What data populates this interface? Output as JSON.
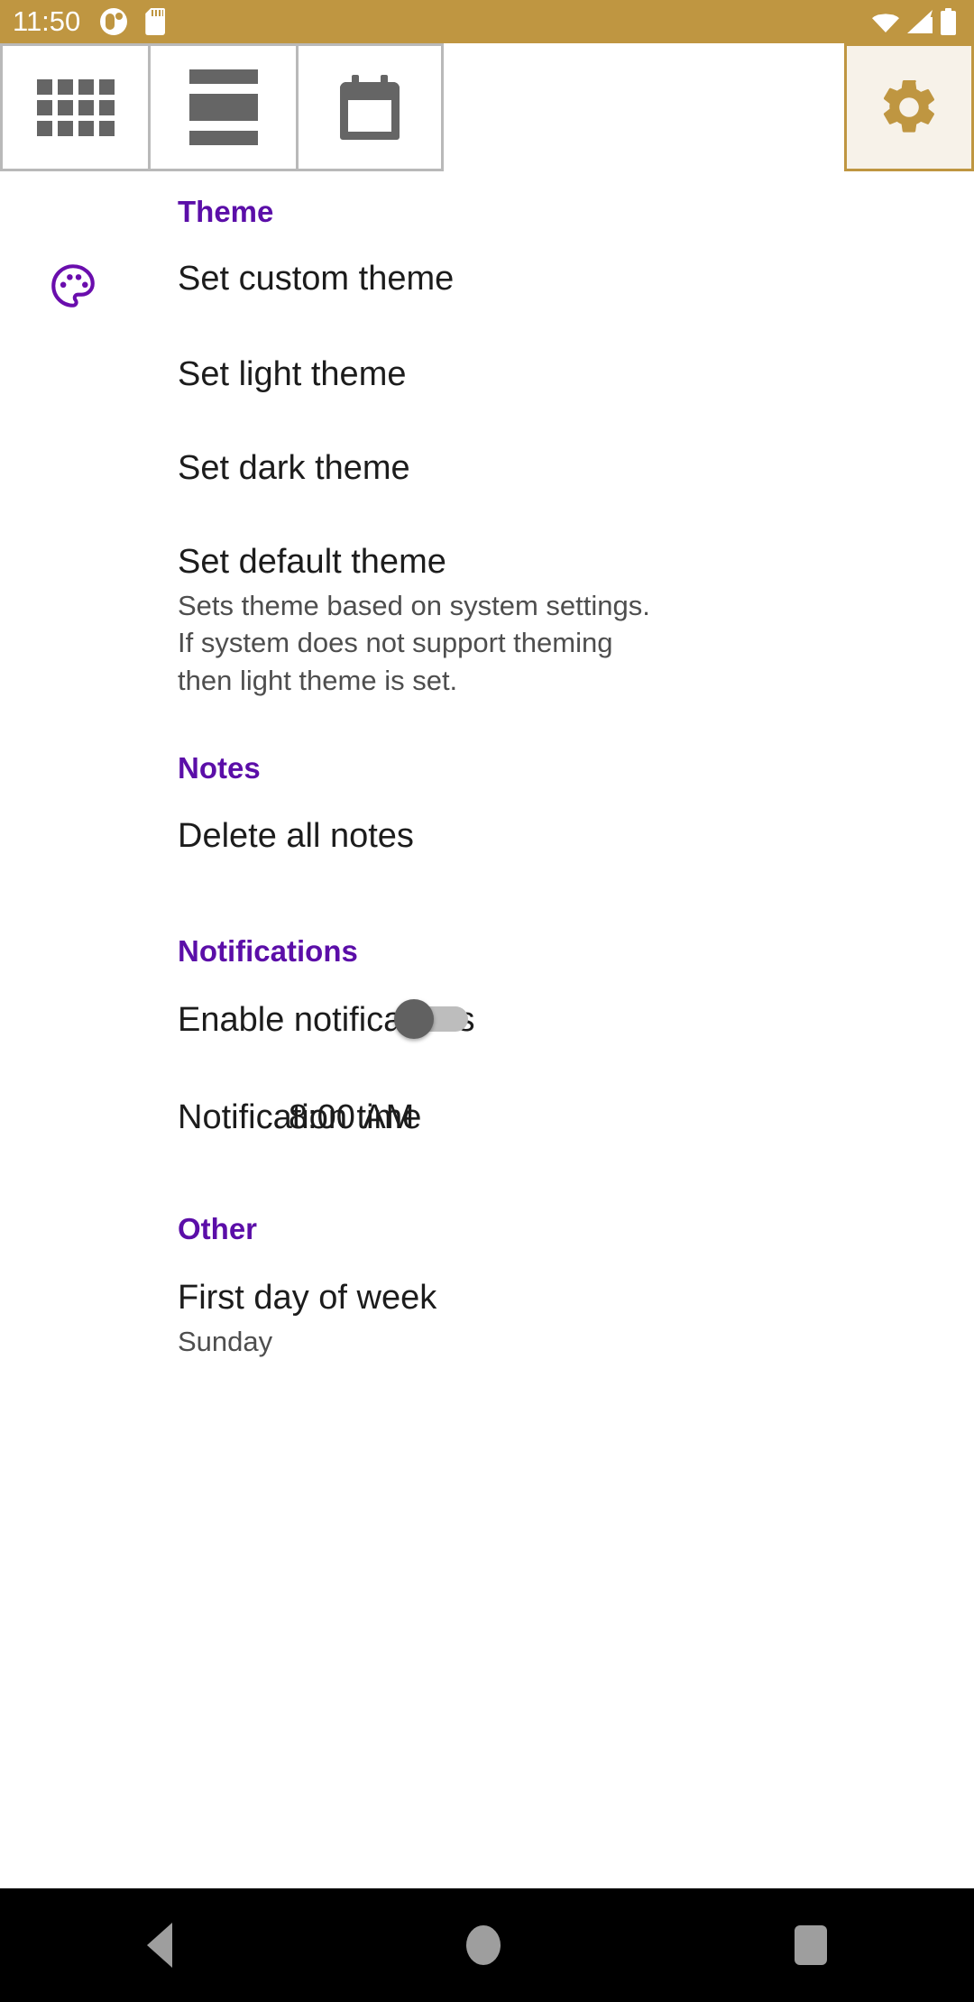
{
  "status_bar": {
    "time": "11:50",
    "icons_left": [
      "app-circle-icon",
      "sd-card-icon"
    ],
    "icons_right": [
      "wifi-icon",
      "cellular-signal-icon",
      "battery-icon"
    ],
    "background_color": "#bf9641"
  },
  "tab_bar": {
    "tabs": [
      {
        "name": "grid-view",
        "icon": "grid-icon",
        "selected": false
      },
      {
        "name": "list-view",
        "icon": "list-icon",
        "selected": false
      },
      {
        "name": "calendar-view",
        "icon": "calendar-icon",
        "selected": false
      }
    ],
    "settings_tab": {
      "name": "settings",
      "icon": "gear-icon",
      "selected": true
    },
    "accent_color": "#bf9641",
    "selected_background": "#f7f2e9"
  },
  "settings": {
    "section_theme": {
      "header": "Theme",
      "items": [
        {
          "title": "Set custom theme",
          "subtitle": "",
          "icon": "palette-icon"
        },
        {
          "title": "Set light theme",
          "subtitle": "",
          "icon": ""
        },
        {
          "title": "Set dark theme",
          "subtitle": "",
          "icon": ""
        },
        {
          "title": "Set default theme",
          "subtitle": "Sets theme based on system settings. If system does not support theming then light theme is set.",
          "icon": ""
        }
      ]
    },
    "section_notes": {
      "header": "Notes",
      "items": [
        {
          "title": "Delete all notes",
          "subtitle": "",
          "icon": ""
        }
      ]
    },
    "section_notifications": {
      "header": "Notifications",
      "items": [
        {
          "title": "Enable notifications",
          "subtitle": "",
          "toggle": false
        },
        {
          "title": "Notification time",
          "subtitle": "",
          "value": "8:00 AM"
        }
      ]
    },
    "section_other": {
      "header": "Other",
      "items": [
        {
          "title": "First day of week",
          "subtitle": "Sunday"
        }
      ]
    },
    "header_color": "#5b0ea8",
    "title_color": "#1c1c1c",
    "subtitle_color": "#4e4e4e"
  },
  "nav_bar": {
    "buttons": [
      "back-button",
      "home-button",
      "recents-button"
    ],
    "background_color": "#000000",
    "icon_color": "#9e9e9e"
  }
}
